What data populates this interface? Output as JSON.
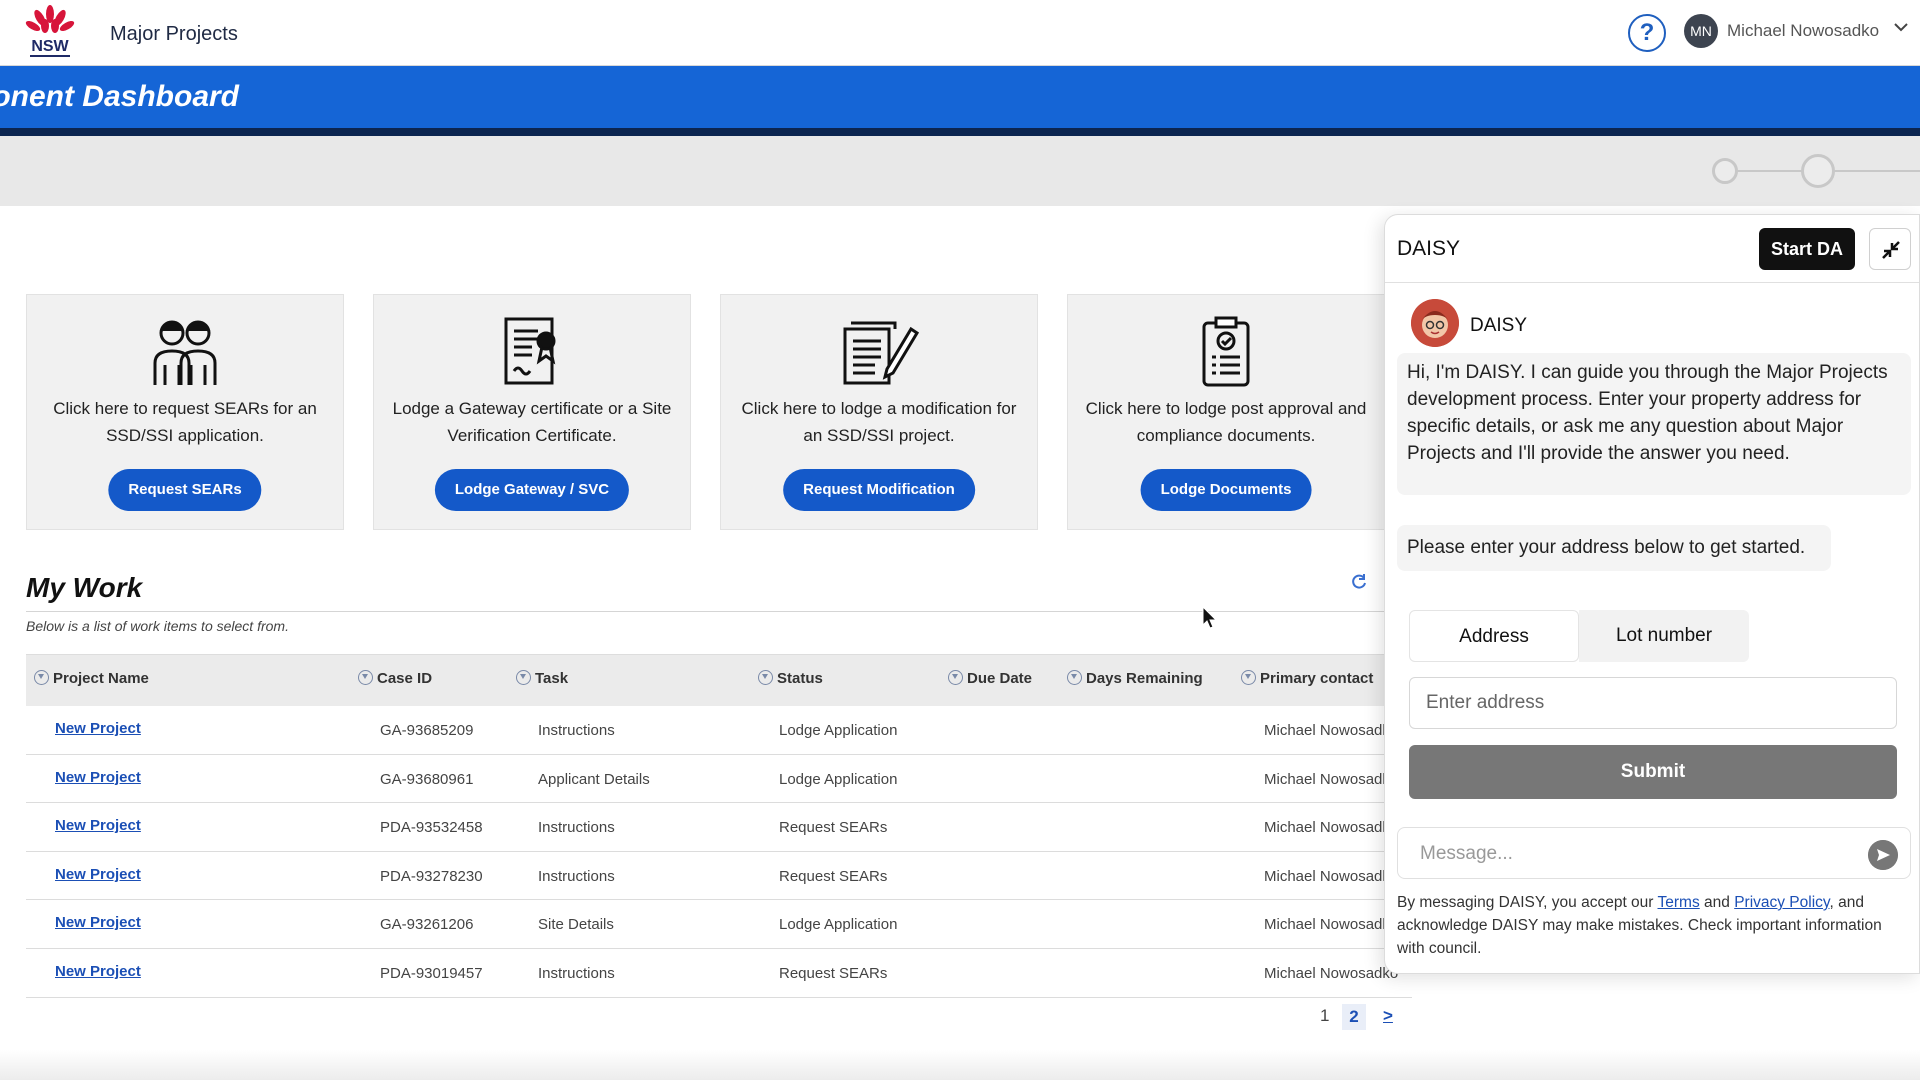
{
  "header": {
    "logo_text": "NSW",
    "app_title": "Major Projects",
    "help_icon": "question-circle-icon",
    "user": {
      "initials": "MN",
      "name": "Michael Nowosadko"
    }
  },
  "page": {
    "title": "ponent Dashboard"
  },
  "cards": [
    {
      "icon": "people-icon",
      "text": "Click here to request SEARs for an SSD/SSI application.",
      "button": "Request SEARs"
    },
    {
      "icon": "certificate-document-icon",
      "text": "Lodge a Gateway certificate or a Site Verification Certificate.",
      "button": "Lodge Gateway / SVC"
    },
    {
      "icon": "document-edit-icon",
      "text": "Click here to lodge a modification for an SSD/SSI project.",
      "button": "Request Modification"
    },
    {
      "icon": "clipboard-check-icon",
      "text": "Click here to lodge post approval and compliance documents.",
      "button": "Lodge Documents"
    }
  ],
  "my_work": {
    "title": "My Work",
    "subtitle": "Below is a list of work items to select from.",
    "columns": [
      "Project Name",
      "Case ID",
      "Task",
      "Status",
      "Due Date",
      "Days Remaining",
      "Primary contact"
    ],
    "rows": [
      {
        "project": "New Project",
        "case_id": "GA-93685209",
        "task": "Instructions",
        "status": "Lodge Application",
        "due": "",
        "days": "",
        "contact": "Michael Nowosadko"
      },
      {
        "project": "New Project",
        "case_id": "GA-93680961",
        "task": "Applicant Details",
        "status": "Lodge Application",
        "due": "",
        "days": "",
        "contact": "Michael Nowosadko"
      },
      {
        "project": "New Project",
        "case_id": "PDA-93532458",
        "task": "Instructions",
        "status": "Request SEARs",
        "due": "",
        "days": "",
        "contact": "Michael Nowosadko"
      },
      {
        "project": "New Project",
        "case_id": "PDA-93278230",
        "task": "Instructions",
        "status": "Request SEARs",
        "due": "",
        "days": "",
        "contact": "Michael Nowosadko"
      },
      {
        "project": "New Project",
        "case_id": "GA-93261206",
        "task": "Site Details",
        "status": "Lodge Application",
        "due": "",
        "days": "",
        "contact": "Michael Nowosadko"
      },
      {
        "project": "New Project",
        "case_id": "PDA-93019457",
        "task": "Instructions",
        "status": "Request SEARs",
        "due": "",
        "days": "",
        "contact": "Michael Nowosadko"
      }
    ],
    "pagination": {
      "pages": [
        "1",
        "2"
      ],
      "current": "2",
      "next": ">"
    }
  },
  "daisy": {
    "title": "DAISY",
    "start_button": "Start DA",
    "bot_name": "DAISY",
    "greeting": "Hi, I'm DAISY. I can guide you through the Major Projects development process. Enter your property address for specific details, or ask me any question about Major Projects and I'll provide the answer you need.",
    "prompt": "Please enter your address below to get started.",
    "tabs": [
      "Address",
      "Lot number"
    ],
    "active_tab": "Address",
    "address_placeholder": "Enter address",
    "submit_label": "Submit",
    "message_placeholder": "Message...",
    "disclaimer_prefix": "By messaging DAISY, you accept our ",
    "terms_link": "Terms",
    "disclaimer_and": " and ",
    "privacy_link": "Privacy Policy",
    "disclaimer_suffix": ", and acknowledge DAISY may make mistakes. Check important information with council."
  },
  "colors": {
    "brand_blue": "#1565d6",
    "button_blue": "#1459c9",
    "navy": "#0c2550",
    "nsw_red": "#d7153a"
  }
}
